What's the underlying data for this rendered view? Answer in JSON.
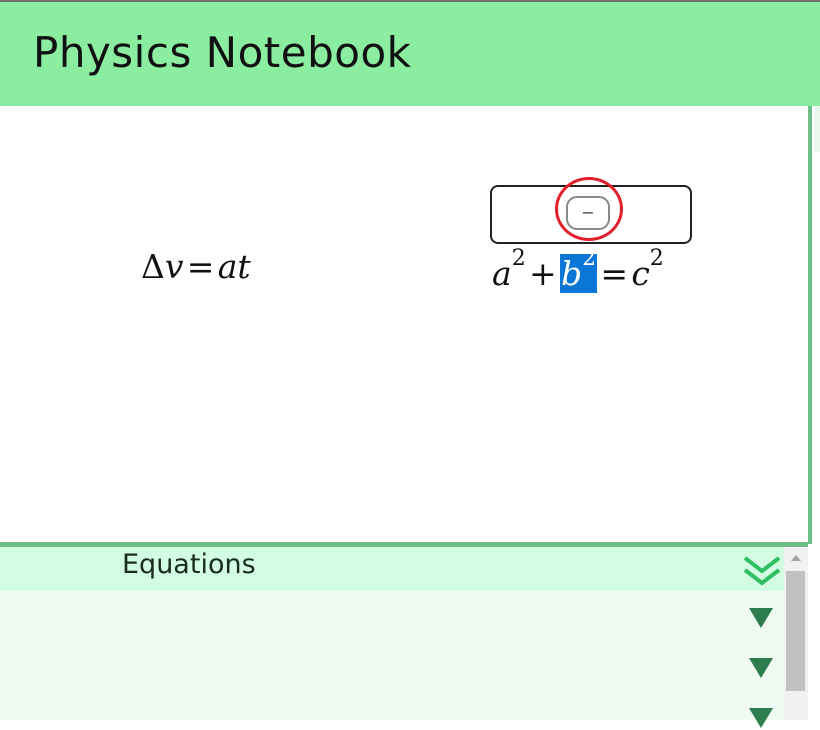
{
  "app": {
    "title": "Physics Notebook"
  },
  "canvas": {
    "equations": [
      {
        "label": "Δv = at"
      },
      {
        "label": "a2 + b2 = c2",
        "selected_term": "b2"
      }
    ],
    "editor_popup": {
      "button_label": "−",
      "button_icon": "minus-icon"
    }
  },
  "panel": {
    "title": "Equations",
    "collapse_icon": "double-chevron-down-icon",
    "row_toggle_icon": "triangle-down-icon"
  },
  "colors": {
    "header_bg": "#8beda0",
    "panel_header_bg": "#d3fde3",
    "panel_body_bg": "#eef9f1",
    "accent_green": "#6ebf85",
    "selection_blue": "#0a76d6",
    "focus_ring_red": "#e0202b"
  }
}
